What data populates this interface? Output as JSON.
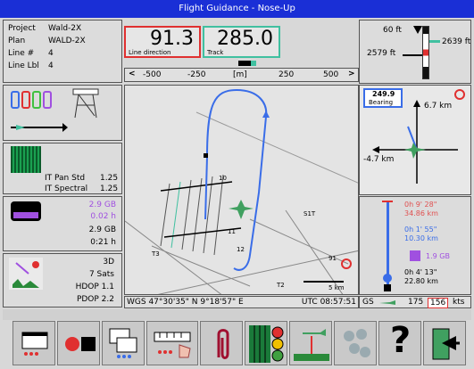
{
  "window": {
    "title": "Flight Guidance - Nose-Up"
  },
  "project_panel": {
    "rows": [
      {
        "label": "Project",
        "value": "Wald-2X"
      },
      {
        "label": "Plan",
        "value": "WALD-2X"
      },
      {
        "label": "Line #",
        "value": "4"
      },
      {
        "label": "Line Lbl",
        "value": "4"
      }
    ]
  },
  "header": {
    "line_direction_value": "91.3",
    "line_direction_label": "Line direction",
    "track_value": "285.0",
    "track_label": "Track"
  },
  "offset_scale": {
    "left_arrow": "<",
    "right_arrow": ">",
    "ticks": [
      "-500",
      "-250",
      "[m]",
      "250",
      "500"
    ]
  },
  "altitude_panel": {
    "top_value": "60 ft",
    "right_value": "2639 ft",
    "left_value": "2579 ft"
  },
  "scanner_panel": {
    "it_pan_std_label": "IT Pan Std",
    "it_pan_std_value": "1.25",
    "it_spectral_label": "IT Spectral",
    "it_spectral_value": "1.25"
  },
  "storage_panel": {
    "free_value": "2.9 GB",
    "used_value": "0.02 h",
    "total_value": "2.9 GB",
    "time_value": "0:21 h"
  },
  "gps_panel": {
    "fix": "3D",
    "sats": "7 Sats",
    "hdop": "HDOP 1.1",
    "pdop": "PDOP 2.2"
  },
  "bearing_panel": {
    "bearing_value": "249.9",
    "bearing_label": "Bearing",
    "north_km": "6.7 km",
    "west_km": "-4.7 km"
  },
  "eta_panel": {
    "time_1": "0h 9' 28\"",
    "dist_1": "34.86 km",
    "time_2": "0h 1' 55\"",
    "dist_2": "10.30 km",
    "storage": "1.9 GB",
    "time_3": "0h 4' 13\"",
    "dist_3": "22.80 km"
  },
  "map": {
    "line_labels": [
      "10",
      "11",
      "12",
      "T2",
      "T3",
      "91",
      "S1T"
    ],
    "scale_label": "5 km"
  },
  "status_bar": {
    "coordinates": "WGS  47°30'35\" N   9°18'57\" E",
    "utc": "UTC 08:57:51",
    "gs_label": "GS",
    "gs_value": "175",
    "gs_value_2": "156",
    "gs_unit": "kts"
  },
  "toolbar": {
    "buttons": [
      "window",
      "record",
      "copy",
      "scale-hand",
      "clip",
      "grid-signal",
      "aircraft-profile",
      "dots",
      "help",
      "exit"
    ],
    "help_glyph": "?"
  },
  "colors": {
    "title_bar": "#1a2fd6",
    "track_line": "#3a6de8",
    "line_direction_border": "#e03030",
    "track_border": "#40c0a0",
    "purple": "#a050e0"
  }
}
